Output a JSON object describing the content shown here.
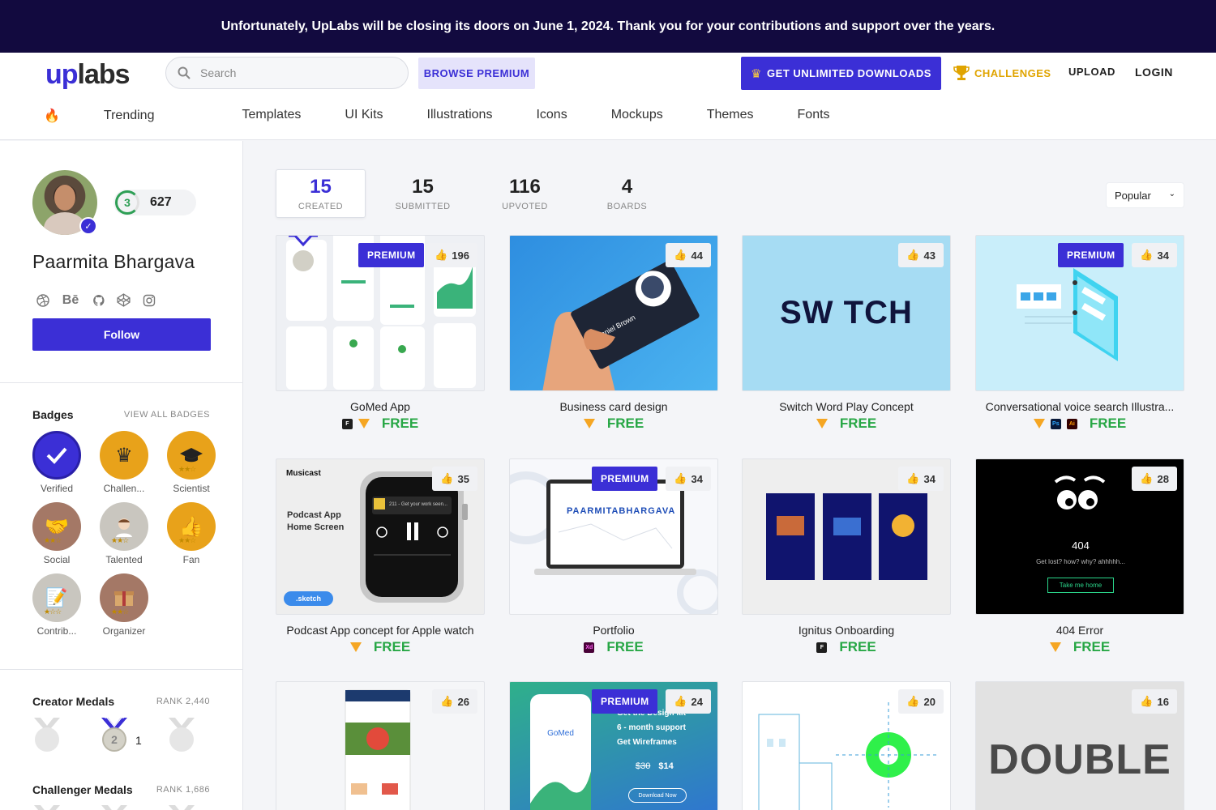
{
  "banner": {
    "text": "Unfortunately, UpLabs will be closing its doors on June 1, 2024. Thank you for your contributions and support over the years."
  },
  "header": {
    "logo_up": "up",
    "logo_labs": "labs",
    "search_placeholder": "Search",
    "browse_premium": "BROWSE PREMIUM",
    "get_unlimited": "GET UNLIMITED DOWNLOADS",
    "challenges": "CHALLENGES",
    "upload": "UPLOAD",
    "login": "LOGIN"
  },
  "categories": [
    "Trending",
    "Templates",
    "UI Kits",
    "Illustrations",
    "Icons",
    "Mockups",
    "Themes",
    "Fonts"
  ],
  "profile": {
    "level": "3",
    "points": "627",
    "name": "Paarmita Bhargava",
    "socials": [
      "dribbble-icon",
      "behance-icon",
      "github-icon",
      "codepen-icon",
      "instagram-icon"
    ],
    "behance_text": "Bē",
    "follow": "Follow"
  },
  "badges": {
    "title": "Badges",
    "view_all": "VIEW ALL BADGES",
    "items": [
      {
        "label": "Verified",
        "color": "#3b2fd6",
        "icon": "checkmark-icon"
      },
      {
        "label": "Challen...",
        "color": "#e8a21a",
        "icon": "trophy-icon"
      },
      {
        "label": "Scientist",
        "color": "#e8a21a",
        "icon": "graduation-cap-icon"
      },
      {
        "label": "Social",
        "color": "#a47866",
        "icon": "handshake-icon"
      },
      {
        "label": "Talented",
        "color": "#c9c6bf",
        "icon": "person-icon"
      },
      {
        "label": "Fan",
        "color": "#e8a21a",
        "icon": "thumbs-up-icon"
      },
      {
        "label": "Contrib...",
        "color": "#c9c6bf",
        "icon": "notepad-icon"
      },
      {
        "label": "Organizer",
        "color": "#a47866",
        "icon": "box-icon"
      }
    ]
  },
  "creator_medals": {
    "title": "Creator Medals",
    "rank": "RANK 2,440",
    "count_label": "2",
    "count": "1"
  },
  "challenger_medals": {
    "title": "Challenger Medals",
    "rank": "RANK 1,686"
  },
  "stats": [
    {
      "num": "15",
      "cap": "CREATED"
    },
    {
      "num": "15",
      "cap": "SUBMITTED"
    },
    {
      "num": "116",
      "cap": "UPVOTED"
    },
    {
      "num": "4",
      "cap": "BOARDS"
    }
  ],
  "sort": {
    "value": "Popular"
  },
  "premium_label": "PREMIUM",
  "cards": [
    {
      "title": "GoMed App",
      "likes": "196",
      "price": "FREE",
      "premium": true,
      "tools": [
        "figma",
        "sketch"
      ]
    },
    {
      "title": "Business card design",
      "likes": "44",
      "price": "FREE",
      "premium": false,
      "tools": [
        "sketch"
      ]
    },
    {
      "title": "Switch Word Play Concept",
      "likes": "43",
      "price": "FREE",
      "premium": false,
      "tools": [
        "sketch"
      ]
    },
    {
      "title": "Conversational voice search Illustra...",
      "likes": "34",
      "price": "FREE",
      "premium": true,
      "tools": [
        "sketch",
        "photoshop",
        "illustrator"
      ]
    },
    {
      "title": "Podcast App concept for Apple watch",
      "likes": "35",
      "price": "FREE",
      "premium": false,
      "tools": [
        "sketch"
      ]
    },
    {
      "title": "Portfolio",
      "likes": "34",
      "price": "FREE",
      "premium": true,
      "tools": [
        "xd"
      ]
    },
    {
      "title": "Ignitus Onboarding",
      "likes": "34",
      "price": "FREE",
      "premium": false,
      "tools": [
        "figma"
      ]
    },
    {
      "title": "404 Error",
      "likes": "28",
      "price": "FREE",
      "premium": false,
      "tools": [
        "sketch"
      ]
    },
    {
      "title": "",
      "likes": "26",
      "price": "",
      "premium": false,
      "tools": []
    },
    {
      "title": "",
      "likes": "24",
      "price": "",
      "premium": true,
      "tools": []
    },
    {
      "title": "",
      "likes": "20",
      "price": "",
      "premium": false,
      "tools": []
    },
    {
      "title": "",
      "likes": "16",
      "price": "",
      "premium": false,
      "tools": []
    }
  ],
  "thumb_text": {
    "switch_word": "SW TCH",
    "podcast_brand": "Musicast",
    "podcast_caption": "Podcast App\nHome Screen",
    "sketch_pill": ".sketch",
    "podcast_track": "211 - Get your work seen...",
    "portfolio_name": "PAARMITABHARGAVA",
    "err_code": "404",
    "err_msg": "Get lost? how? why? ahhhhh...",
    "err_btn": "Take me home",
    "card_name": "Daniel Brown",
    "gomed_brand": "GoMed",
    "gomed_features": [
      "Get the Design kit",
      "6 - month support",
      "Get Wireframes"
    ],
    "gomed_old_price": "$30",
    "gomed_price": "$14",
    "gomed_cta": "Download Now",
    "double_text": "DOUBLE"
  }
}
